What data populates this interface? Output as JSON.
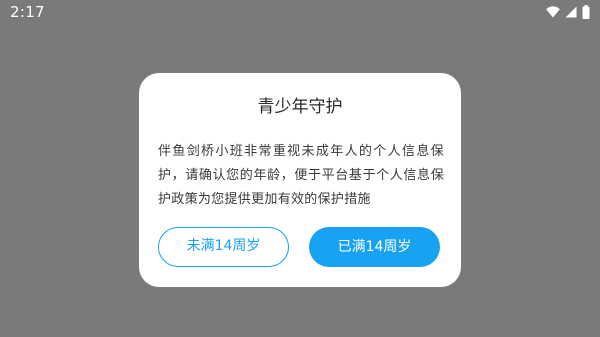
{
  "status_bar": {
    "time": "2:17",
    "icons": [
      "wifi-icon",
      "cellular-signal-icon",
      "battery-icon"
    ]
  },
  "dialog": {
    "title": "青少年守护",
    "message": "伴鱼剑桥小班非常重视未成年人的个人信息保护，请确认您的年龄，便于平台基于个人信息保护政策为您提供更加有效的保护措施",
    "buttons": {
      "under_14_label": "未满14周岁",
      "over_14_label": "已满14周岁"
    }
  },
  "colors": {
    "accent": "#17a3f2",
    "scrim": "#7a7a7a",
    "dialog_bg": "#ffffff"
  }
}
